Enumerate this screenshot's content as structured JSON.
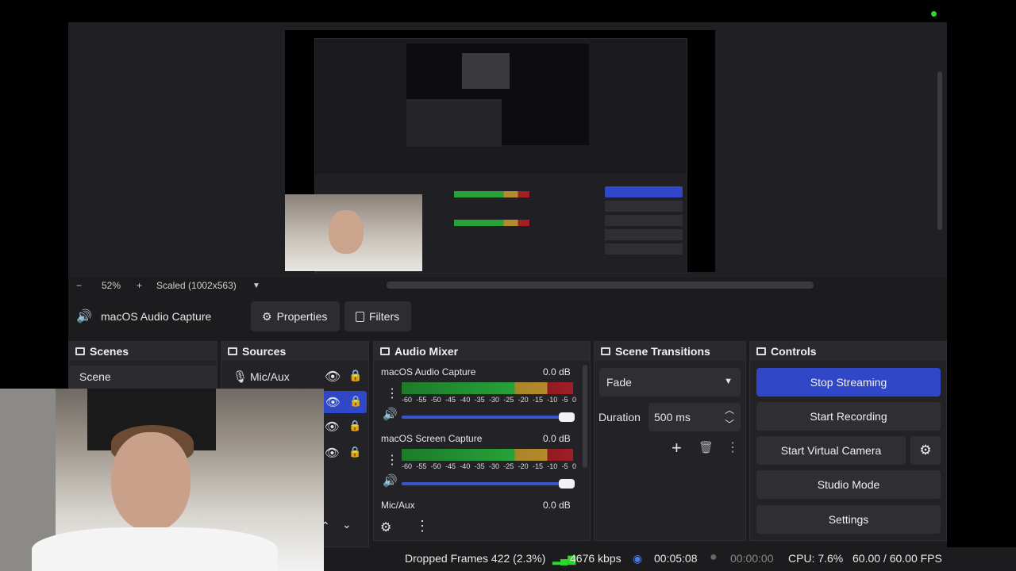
{
  "preview": {
    "zoom": "52%",
    "scale": "Scaled (1002x563)",
    "zoom_out": "−",
    "zoom_in": "+"
  },
  "toolbar": {
    "source_name": "macOS Audio Capture",
    "properties": "Properties",
    "filters": "Filters"
  },
  "docks": {
    "scenes": {
      "title": "Scenes",
      "items": [
        "Scene"
      ]
    },
    "sources": {
      "title": "Sources",
      "items": [
        {
          "label": "Mic/Aux"
        }
      ]
    },
    "mixer": {
      "title": "Audio Mixer",
      "channels": [
        {
          "name": "macOS Audio Capture",
          "db": "0.0 dB"
        },
        {
          "name": "macOS Screen Capture",
          "db": "0.0 dB"
        },
        {
          "name": "Mic/Aux",
          "db": "0.0 dB"
        }
      ],
      "ticks": [
        "-60",
        "-55",
        "-50",
        "-45",
        "-40",
        "-35",
        "-30",
        "-25",
        "-20",
        "-15",
        "-10",
        "-5",
        "0"
      ]
    },
    "transitions": {
      "title": "Scene Transitions",
      "selected": "Fade",
      "duration_label": "Duration",
      "duration_value": "500 ms"
    },
    "controls": {
      "title": "Controls",
      "stop_streaming": "Stop Streaming",
      "start_recording": "Start Recording",
      "start_virtual_camera": "Start Virtual Camera",
      "studio_mode": "Studio Mode",
      "settings": "Settings"
    }
  },
  "status": {
    "dropped": "Dropped Frames 422 (2.3%)",
    "bitrate": "4676 kbps",
    "stream_time": "00:05:08",
    "record_time": "00:00:00",
    "cpu": "CPU: 7.6%",
    "fps": "60.00 / 60.00 FPS"
  },
  "colors": {
    "accent": "#3048c8",
    "live_dot": "#2bd82b",
    "meter_green": "#27a23a",
    "meter_yellow": "#b58a2a",
    "meter_red": "#a01f28"
  }
}
